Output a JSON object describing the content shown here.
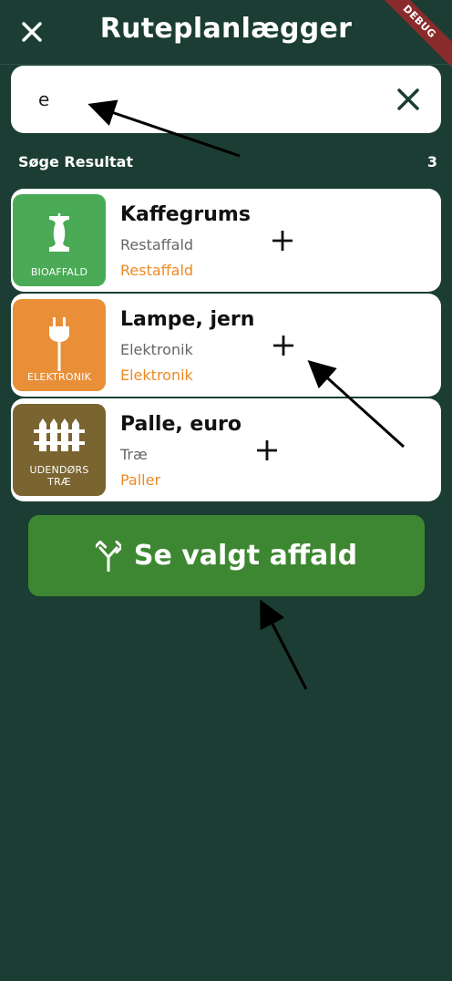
{
  "header": {
    "title": "Ruteplanlægger",
    "debug_label": "DEBUG"
  },
  "search": {
    "value": "e"
  },
  "results": {
    "label": "Søge Resultat",
    "count": "3",
    "items": [
      {
        "name": "Kaffegrums",
        "subtitle": "Restaffald",
        "category": "Restaffald",
        "tile_label": "BIOAFFALD",
        "tile_color": "#4aaa55",
        "icon": "apple-core-icon"
      },
      {
        "name": "Lampe, jern",
        "subtitle": "Elektronik",
        "category": "Elektronik",
        "tile_label": "ELEKTRONIK",
        "tile_color": "#e98f38",
        "icon": "plug-icon"
      },
      {
        "name": "Palle, euro",
        "subtitle": "Træ",
        "category": "Paller",
        "tile_label": "UDENDØRS\nTRÆ",
        "tile_color": "#7a6430",
        "icon": "fence-icon"
      }
    ]
  },
  "cta": {
    "label": "Se valgt affald",
    "icon": "fork-arrow-icon"
  },
  "colors": {
    "background": "#1b3d33",
    "accent": "#3e8732",
    "category_text": "#ee8a22"
  }
}
